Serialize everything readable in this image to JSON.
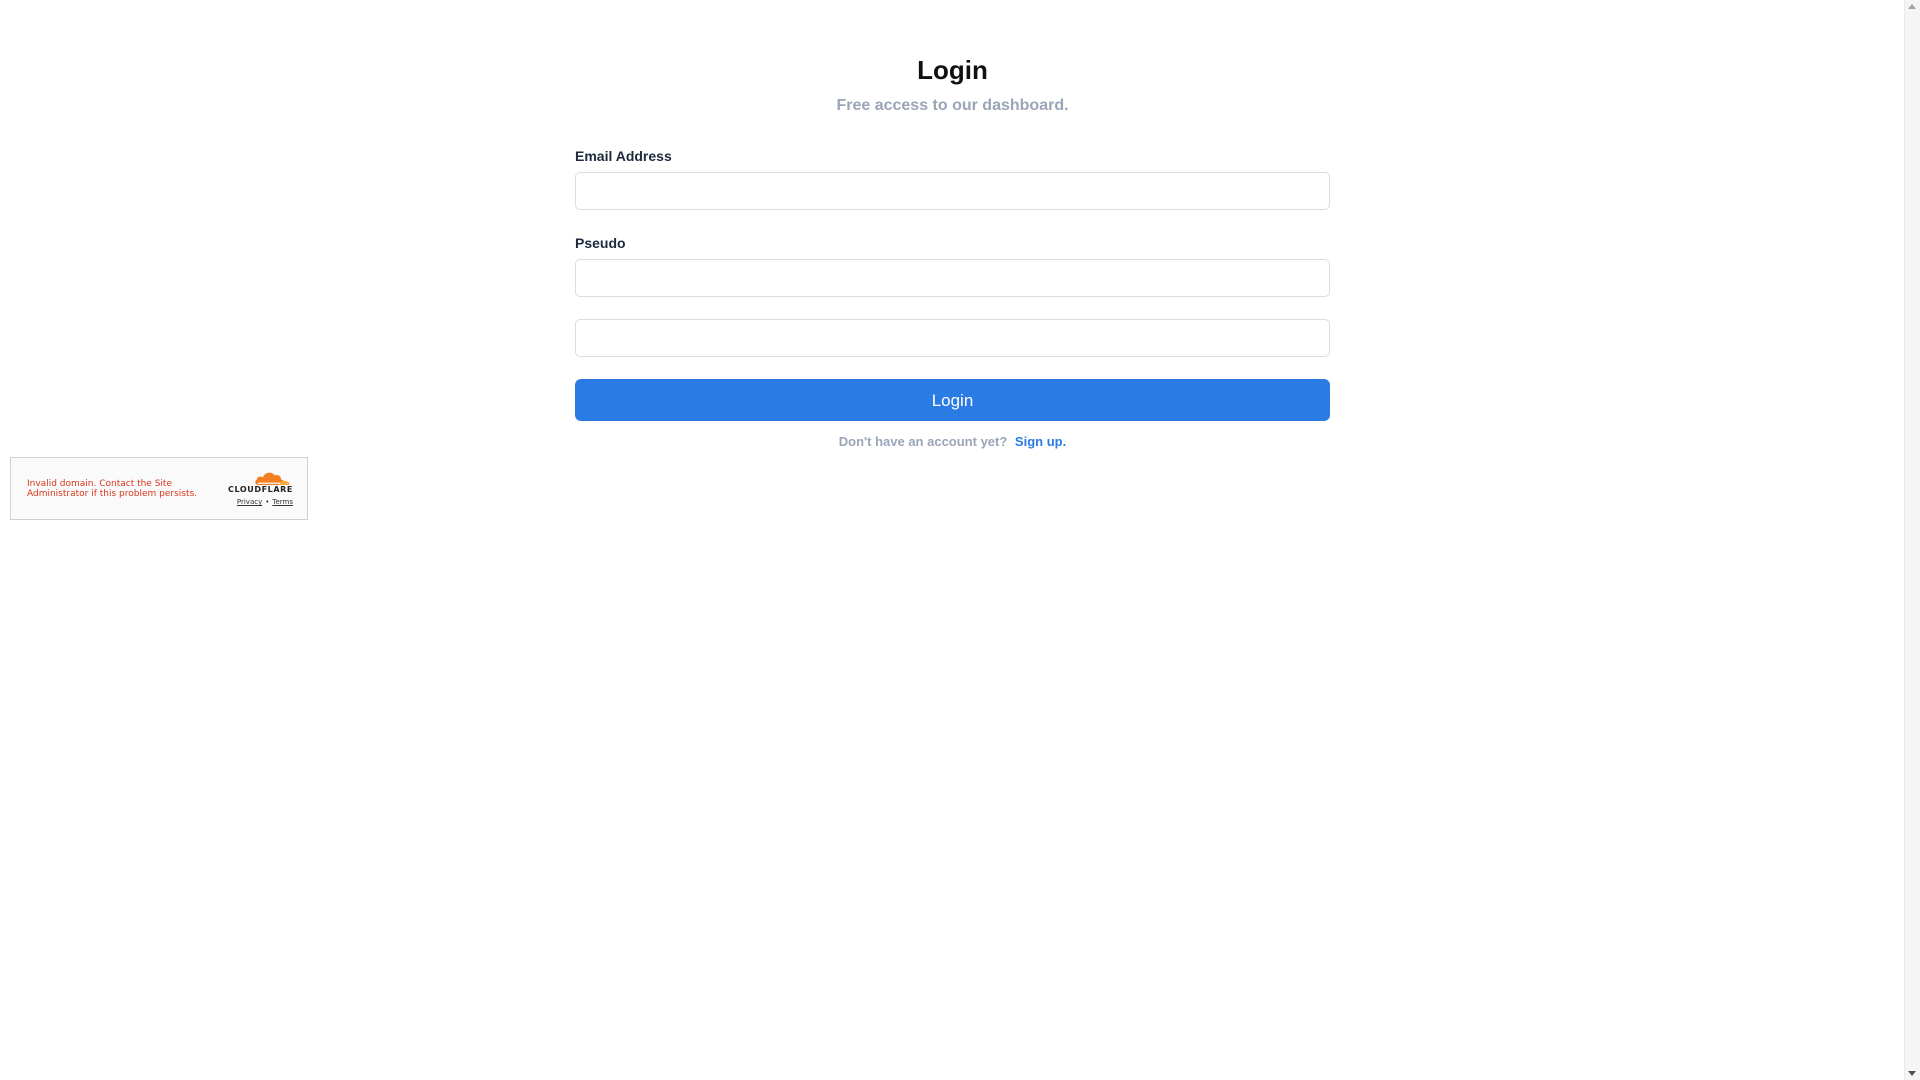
{
  "login": {
    "title": "Login",
    "subtitle": "Free access to our dashboard.",
    "email_label": "Email Address",
    "email_value": "",
    "pseudo_label": "Pseudo",
    "pseudo_value": "",
    "extra_value": "",
    "button_label": "Login",
    "signup_prompt": "Don't have an account yet?",
    "signup_link": "Sign up."
  },
  "cloudflare_widget": {
    "error_message": "Invalid domain. Contact the Site Administrator if this problem persists.",
    "brand": "CLOUDFLARE",
    "privacy_link": "Privacy",
    "separator": "•",
    "terms_link": "Terms"
  },
  "colors": {
    "accent": "#2b7be5",
    "muted_text": "#9aa5b8",
    "error": "#d9361f",
    "cloudflare_orange": "#f38020"
  },
  "icons": {
    "cloudflare_logo": "cloudflare-cloud-icon",
    "scroll_up": "chevron-up-icon",
    "scroll_down": "chevron-down-icon"
  }
}
